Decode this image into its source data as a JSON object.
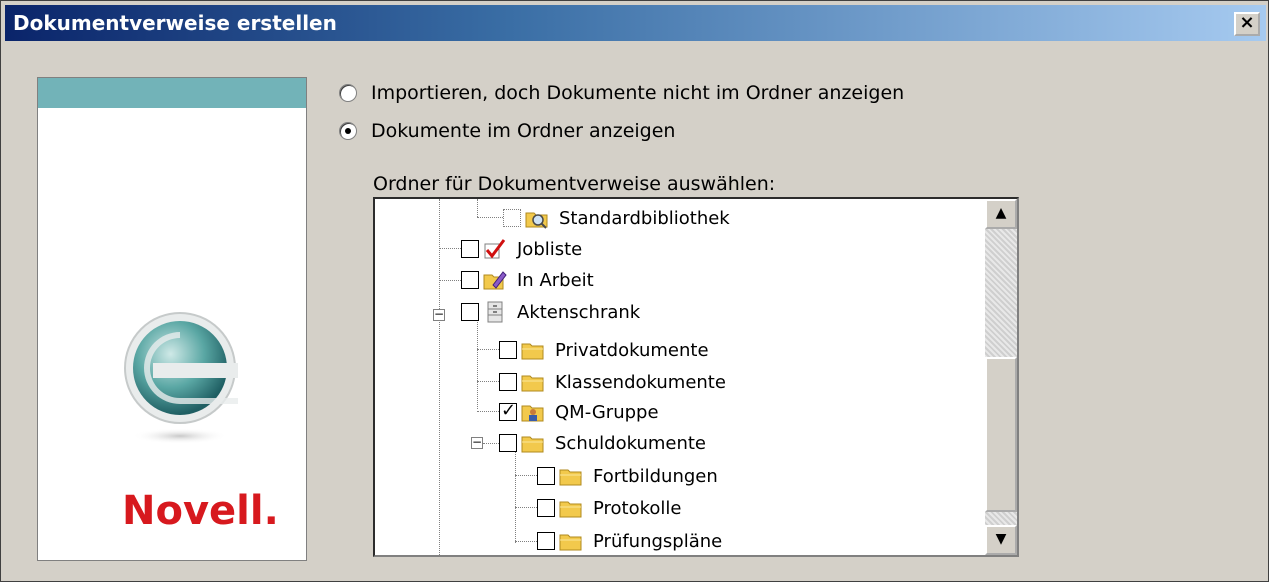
{
  "window": {
    "title": "Dokumentverweise erstellen",
    "close_glyph": "×"
  },
  "branding": {
    "logo_text": "Novell.",
    "accent": "#d7191e",
    "band_color": "#72b3b8"
  },
  "options": [
    {
      "label": "Importieren, doch Dokumente nicht im Ordner anzeigen",
      "selected": false
    },
    {
      "label": "Dokumente im Ordner anzeigen",
      "selected": true
    }
  ],
  "folder_select_label": "Ordner für Dokumentverweise auswählen:",
  "tree": [
    {
      "label": "Standardbibliothek",
      "icon": "library-search-icon",
      "checked": false
    },
    {
      "label": "Jobliste",
      "icon": "red-checkmark-icon",
      "checked": false
    },
    {
      "label": "In Arbeit",
      "icon": "folder-edit-icon",
      "checked": false
    },
    {
      "label": "Aktenschrank",
      "icon": "filing-cabinet-icon",
      "checked": false,
      "expanded": true
    },
    {
      "label": "Privatdokumente",
      "icon": "folder-icon",
      "checked": false
    },
    {
      "label": "Klassendokumente",
      "icon": "folder-icon",
      "checked": false
    },
    {
      "label": "QM-Gruppe",
      "icon": "group-folder-icon",
      "checked": true
    },
    {
      "label": "Schuldokumente",
      "icon": "folder-icon",
      "checked": false,
      "expanded": true
    },
    {
      "label": "Fortbildungen",
      "icon": "folder-icon",
      "checked": false
    },
    {
      "label": "Protokolle",
      "icon": "folder-icon",
      "checked": false
    },
    {
      "label": "Prüfungspläne",
      "icon": "folder-icon",
      "checked": false
    }
  ],
  "scroll": {
    "up_glyph": "▲",
    "down_glyph": "▼"
  }
}
